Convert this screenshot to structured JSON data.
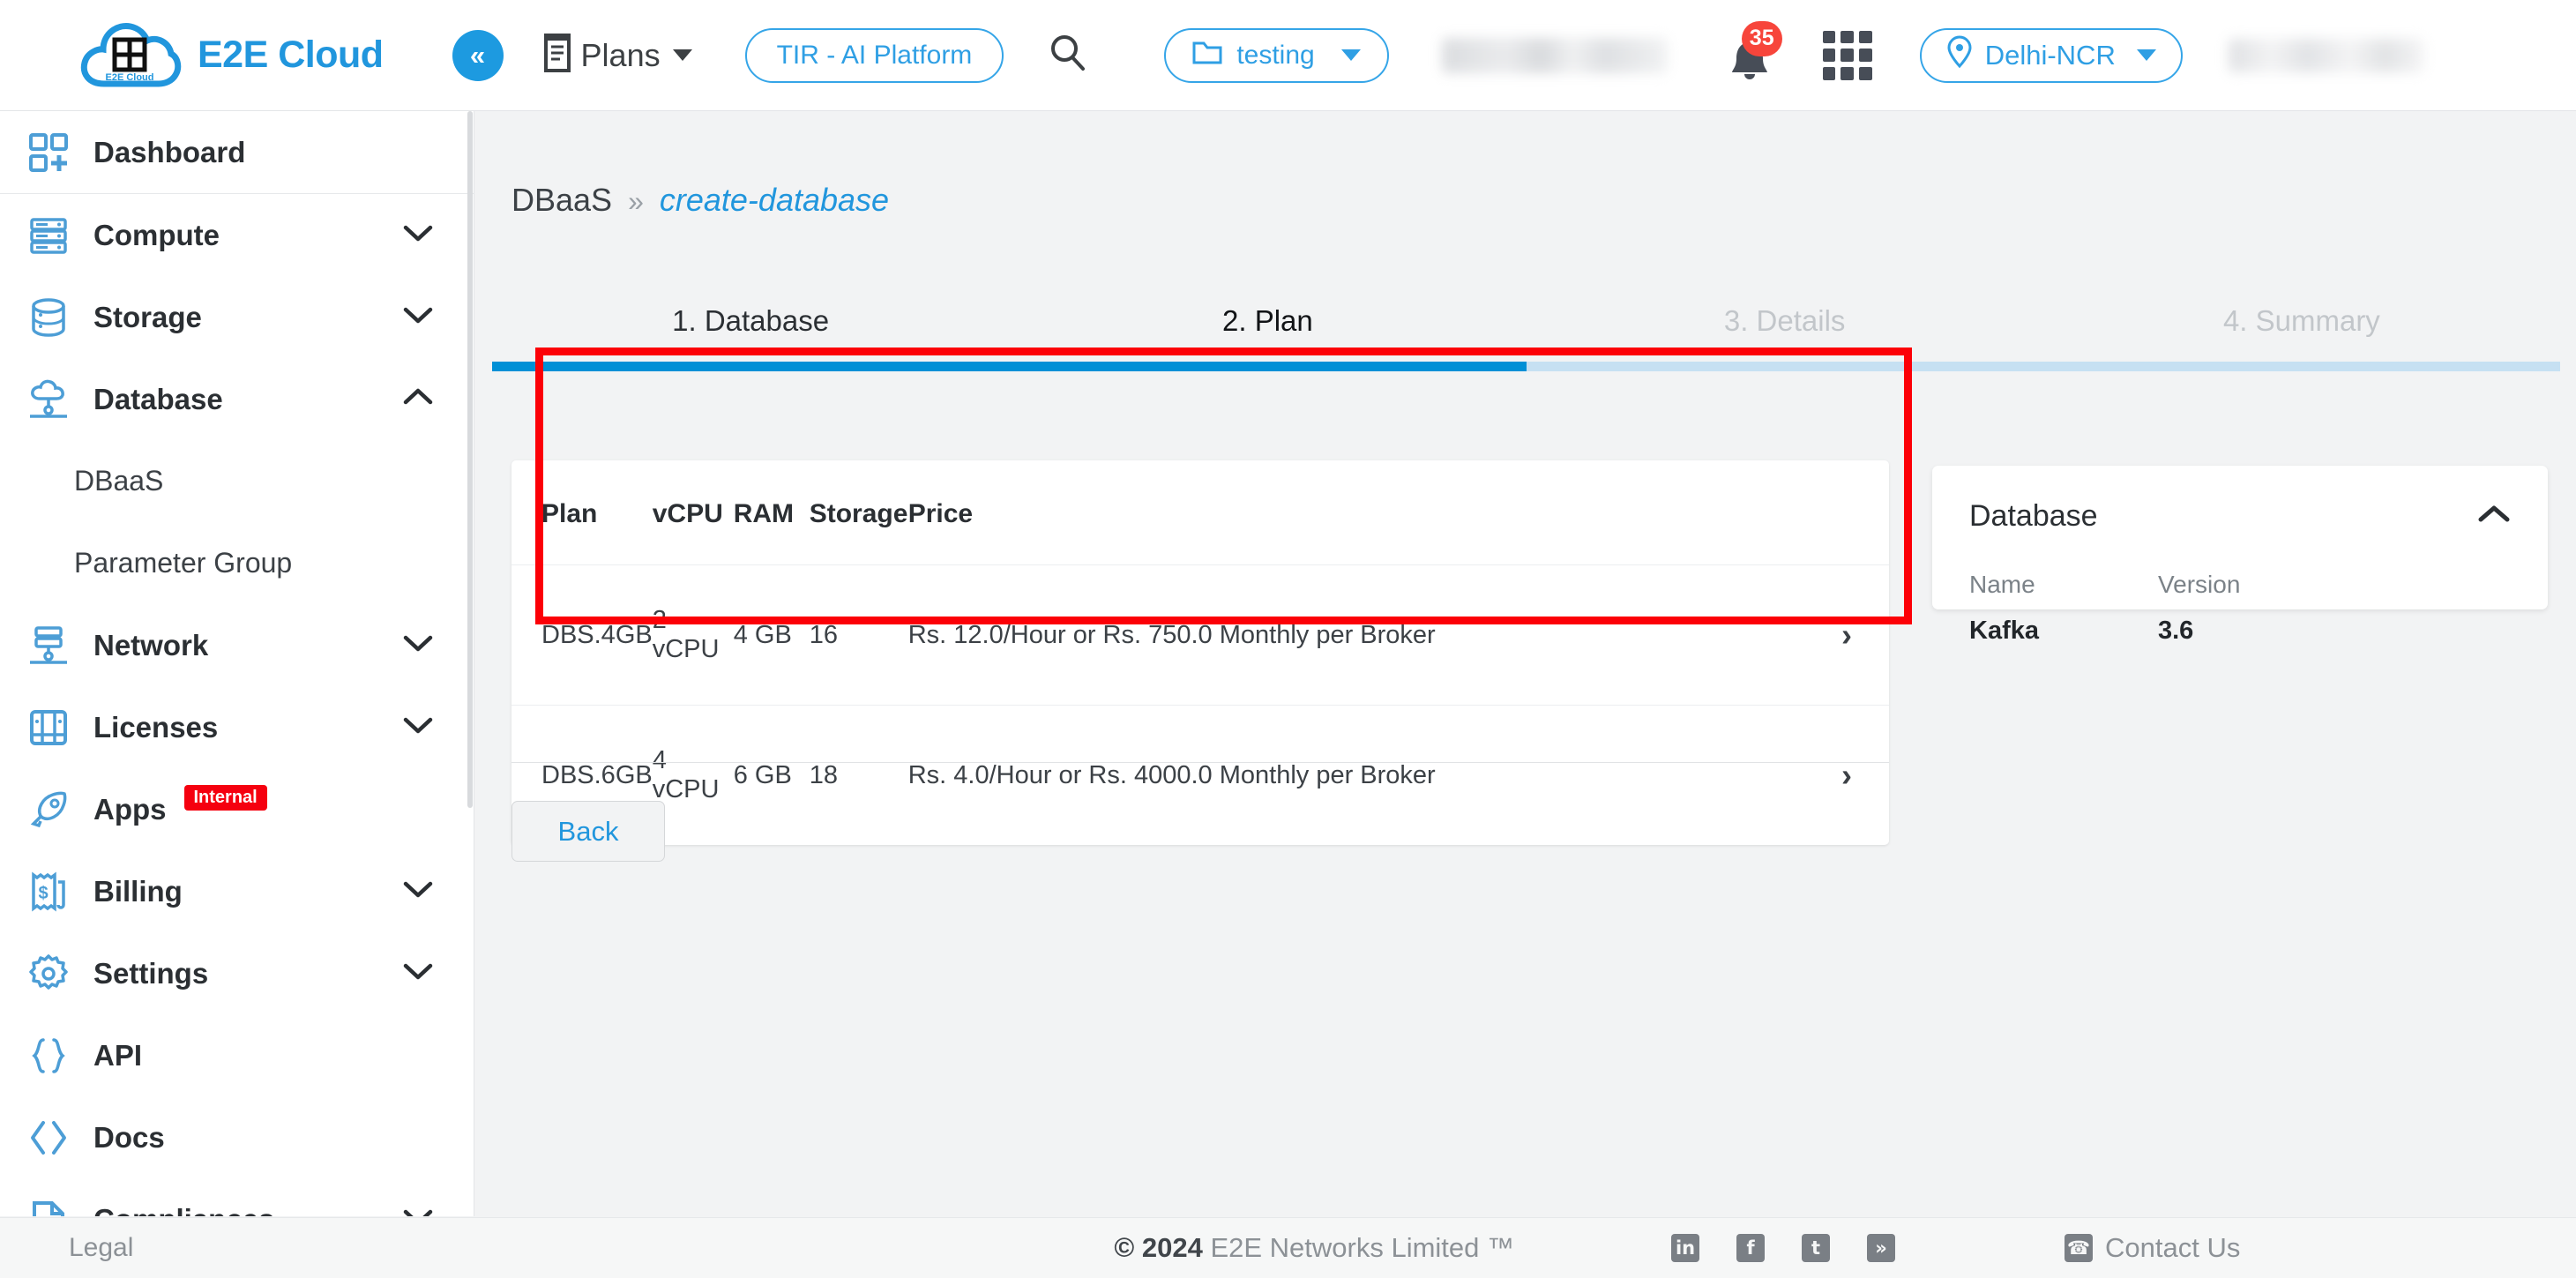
{
  "header": {
    "brand": "E2E Cloud",
    "logo_text": "E2E Cloud",
    "collapse_icon": "double-chevron-left-icon",
    "plans_label": "Plans",
    "plans_icon": "invoice-icon",
    "tir_button": "TIR - AI Platform",
    "search_icon": "search-icon",
    "project_label": "testing",
    "project_icon": "folder-icon",
    "account_name_masked": "",
    "notifications_count": "35",
    "bell_icon": "bell-icon",
    "apps_grid_icon": "grid-apps-icon",
    "region_label": "Delhi-NCR",
    "region_icon": "location-pin-icon",
    "user_masked": ""
  },
  "sidebar": {
    "items": [
      {
        "label": "Dashboard",
        "icon": "dashboard-add-icon",
        "chevron": "",
        "sub": []
      },
      {
        "label": "Compute",
        "icon": "server-icon",
        "chevron": "down",
        "sub": []
      },
      {
        "label": "Storage",
        "icon": "database-disk-icon",
        "chevron": "down",
        "sub": []
      },
      {
        "label": "Database",
        "icon": "cloud-database-icon",
        "chevron": "up",
        "sub": [
          {
            "label": "DBaaS"
          },
          {
            "label": "Parameter Group"
          }
        ]
      },
      {
        "label": "Network",
        "icon": "network-icon",
        "chevron": "down",
        "sub": []
      },
      {
        "label": "Licenses",
        "icon": "licenses-grid-icon",
        "chevron": "down",
        "sub": []
      },
      {
        "label": "Apps",
        "icon": "rocket-icon",
        "chevron": "",
        "badge": "Internal",
        "sub": []
      },
      {
        "label": "Billing",
        "icon": "billing-receipt-icon",
        "chevron": "down",
        "sub": []
      },
      {
        "label": "Settings",
        "icon": "gear-icon",
        "chevron": "down",
        "sub": []
      },
      {
        "label": "API",
        "icon": "curly-braces-icon",
        "chevron": "",
        "sub": []
      },
      {
        "label": "Docs",
        "icon": "code-angle-icon",
        "chevron": "",
        "sub": []
      },
      {
        "label": "Compliances",
        "icon": "compliance-doc-icon",
        "chevron": "down",
        "sub": []
      }
    ]
  },
  "main": {
    "breadcrumb": {
      "root": "DBaaS",
      "separator": "»",
      "current": "create-database"
    },
    "tabs": [
      {
        "label": "1. Database",
        "state": "done"
      },
      {
        "label": "2. Plan",
        "state": "active"
      },
      {
        "label": "3. Details",
        "state": "inactive"
      },
      {
        "label": "4. Summary",
        "state": "inactive"
      }
    ],
    "progress_percent": "50",
    "plan_table": {
      "columns": [
        "Plan",
        "vCPU",
        "RAM",
        "Storage",
        "Price",
        ""
      ],
      "rows": [
        {
          "plan": "DBS.4GB",
          "vcpu": "2 vCPU",
          "ram": "4 GB",
          "storage": "16",
          "price": "Rs. 12.0/Hour or Rs. 750.0 Monthly per Broker",
          "arrow": "chevron-right-icon"
        },
        {
          "plan": "DBS.6GB",
          "vcpu": "4 vCPU",
          "ram": "6 GB",
          "storage": "18",
          "price": "Rs. 4.0/Hour or Rs. 4000.0 Monthly per Broker",
          "arrow": "chevron-right-icon"
        }
      ]
    },
    "back_button": "Back",
    "summary_card": {
      "title": "Database",
      "collapse_icon": "chevron-up-icon",
      "name_key": "Name",
      "version_key": "Version",
      "name_value": "Kafka",
      "version_value": "3.6"
    },
    "highlight_color": "#fc0007"
  },
  "footer": {
    "legal": "Legal",
    "copyright_year": "© 2024",
    "copyright_rest": "E2E Networks Limited ™",
    "social": [
      {
        "name": "linkedin-icon",
        "glyph": "in"
      },
      {
        "name": "facebook-icon",
        "glyph": "f"
      },
      {
        "name": "twitter-icon",
        "glyph": "t"
      },
      {
        "name": "rss-icon",
        "glyph": "»"
      }
    ],
    "contact": "Contact Us",
    "contact_icon": "phone-icon"
  },
  "colors": {
    "accent": "#2196dd",
    "progress_fill": "#0090d6",
    "progress_track": "#c6e0f2",
    "badge_red": "#f5000f",
    "notification_red": "#f7453b",
    "highlight_red": "#fc0007"
  }
}
